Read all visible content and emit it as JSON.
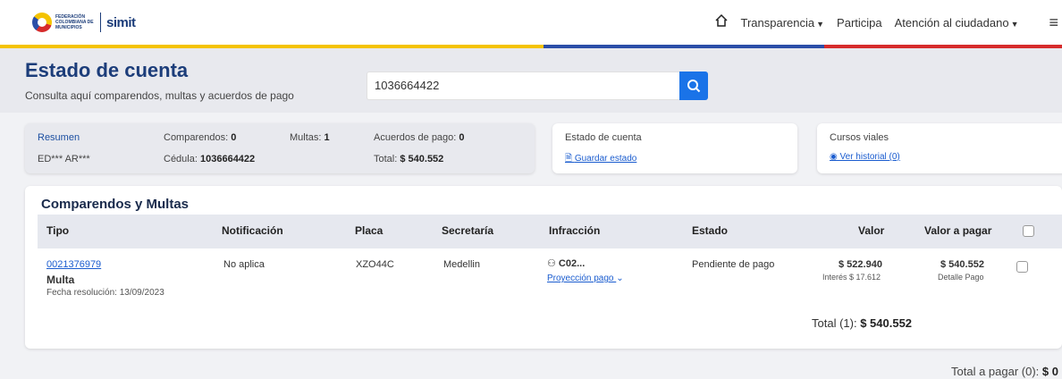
{
  "navbar": {
    "logo_text": "FEDERACIÓN COLOMBIANA DE MUNICIPIOS",
    "logo_simit": "simit",
    "items": [
      "Transparencia",
      "Participa",
      "Atención al ciudadano"
    ]
  },
  "header": {
    "title": "Estado de cuenta",
    "subtitle": "Consulta aquí comparendos, multas y acuerdos de pago",
    "search_value": "1036664422"
  },
  "summary": {
    "title": "Resumen",
    "name": "ED*** AR***",
    "comparendos_label": "Comparendos:",
    "comparendos_value": "0",
    "cedula_label": "Cédula:",
    "cedula_value": "1036664422",
    "multas_label": "Multas:",
    "multas_value": "1",
    "acuerdos_label": "Acuerdos de pago:",
    "acuerdos_value": "0",
    "total_label": "Total:",
    "total_value": "$ 540.552"
  },
  "estado_card": {
    "title": "Estado de cuenta",
    "link": "Guardar estado"
  },
  "cursos_card": {
    "title": "Cursos viales",
    "link": "Ver historial (0)"
  },
  "table": {
    "title": "Comparendos y Multas",
    "headers": [
      "Tipo",
      "Notificación",
      "Placa",
      "Secretaría",
      "Infracción",
      "Estado",
      "Valor",
      "Valor a pagar"
    ],
    "row": {
      "numero": "0021376979",
      "tipo": "Multa",
      "fecha": "Fecha resolución: 13/09/2023",
      "notificacion": "No aplica",
      "placa": "XZO44C",
      "secretaria": "Medellin",
      "infraccion": "C02...",
      "proyeccion": "Proyección pago",
      "estado": "Pendiente de pago",
      "valor": "$ 522.940",
      "interes": "Interés $ 17.612",
      "valor_pagar": "$ 540.552",
      "detalle": "Detalle Pago"
    },
    "total_label": "Total (1):",
    "total_value": "$ 540.552"
  },
  "footer": {
    "label": "Total a pagar (0):",
    "value": "$ 0"
  },
  "colors": {
    "brand_blue": "#1c3d7a",
    "accent": "#1a73e8",
    "flag_yellow": "#f4c300",
    "flag_blue": "#2b4ea8",
    "flag_red": "#d62b2b"
  }
}
